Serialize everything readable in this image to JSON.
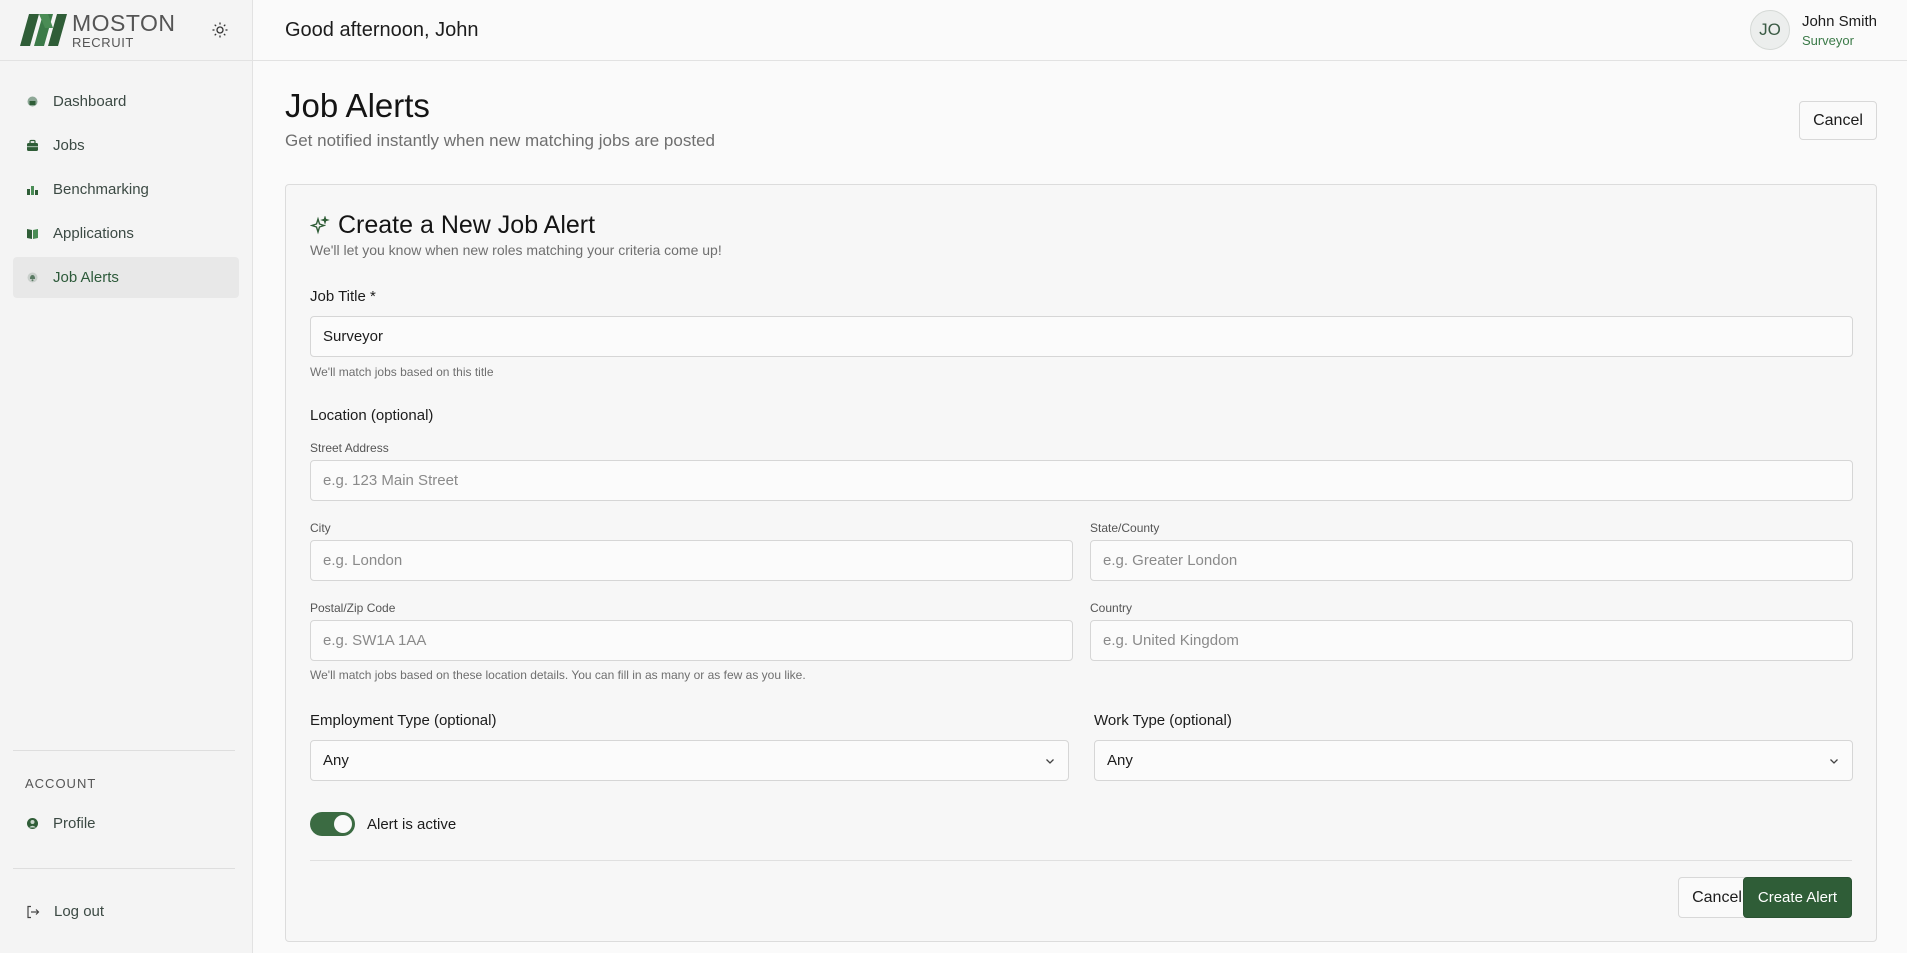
{
  "brand": {
    "name_line1": "MOSTON",
    "name_line2": "RECRUIT"
  },
  "sidebar": {
    "items": [
      {
        "label": "Dashboard",
        "icon": "dashboard-icon"
      },
      {
        "label": "Jobs",
        "icon": "briefcase-icon"
      },
      {
        "label": "Benchmarking",
        "icon": "bar-chart-icon"
      },
      {
        "label": "Applications",
        "icon": "book-icon"
      },
      {
        "label": "Job Alerts",
        "icon": "bell-icon",
        "active": true
      }
    ],
    "account_heading": "ACCOUNT",
    "profile_label": "Profile",
    "logout_label": "Log out"
  },
  "header": {
    "greeting": "Good afternoon, John",
    "user_initials": "JO",
    "user_name": "John Smith",
    "user_role": "Surveyor"
  },
  "page": {
    "title": "Job Alerts",
    "subtitle": "Get notified instantly when new matching jobs are posted",
    "cancel_label": "Cancel"
  },
  "form": {
    "title": "Create a New Job Alert",
    "subtitle": "We'll let you know when new roles matching your criteria come up!",
    "job_title_label": "Job Title *",
    "job_title_value": "Surveyor",
    "job_title_hint": "We'll match jobs based on this title",
    "location_label": "Location (optional)",
    "street_label": "Street Address",
    "street_placeholder": "e.g. 123 Main Street",
    "city_label": "City",
    "city_placeholder": "e.g. London",
    "state_label": "State/County",
    "state_placeholder": "e.g. Greater London",
    "postal_label": "Postal/Zip Code",
    "postal_placeholder": "e.g. SW1A 1AA",
    "country_label": "Country",
    "country_placeholder": "e.g. United Kingdom",
    "location_hint": "We'll match jobs based on these location details. You can fill in as many or as few as you like.",
    "employment_label": "Employment Type (optional)",
    "employment_value": "Any",
    "work_label": "Work Type (optional)",
    "work_value": "Any",
    "active_label": "Alert is active",
    "active": true,
    "cancel_label": "Cancel",
    "create_label": "Create Alert"
  },
  "colors": {
    "accent": "#2f5d37",
    "accent_text": "#3b7a48"
  }
}
